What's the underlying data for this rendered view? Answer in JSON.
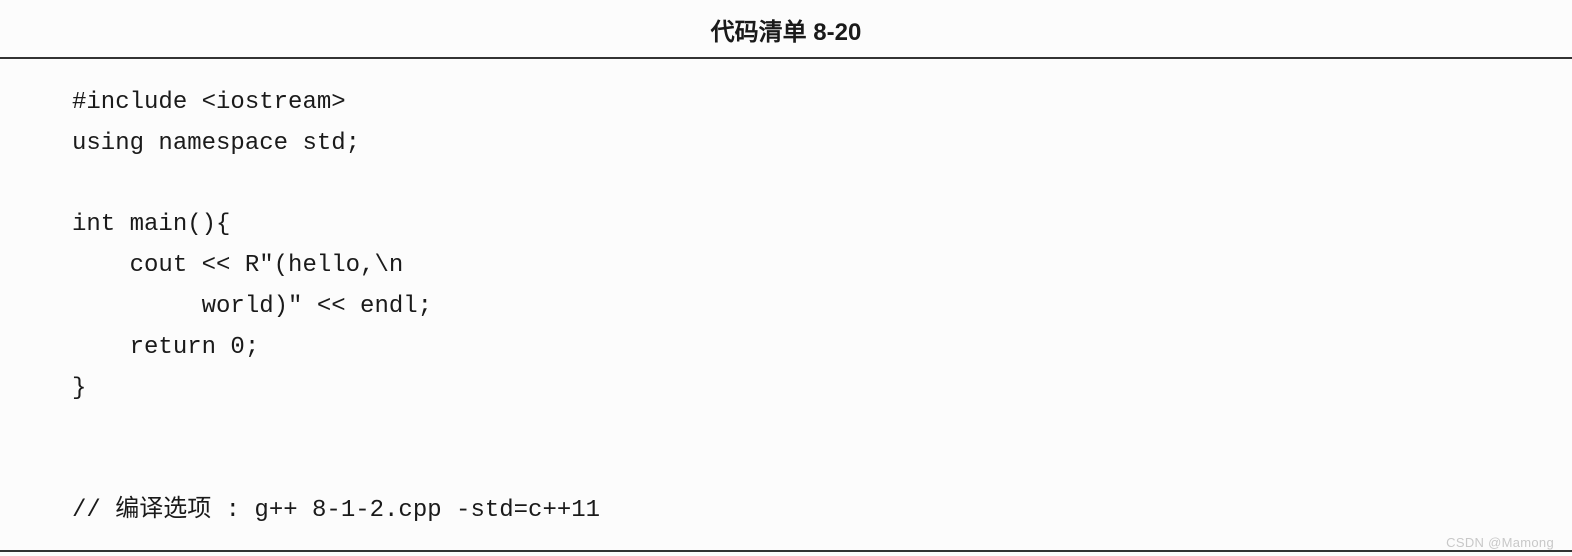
{
  "title": "代码清单 8-20",
  "code": "#include <iostream>\nusing namespace std;\n\nint main(){\n    cout << R\"(hello,\\n\n         world)\" << endl;\n    return 0;\n}\n\n\n// 编译选项 : g++ 8-1-2.cpp -std=c++11",
  "watermark": "CSDN @Mamong"
}
